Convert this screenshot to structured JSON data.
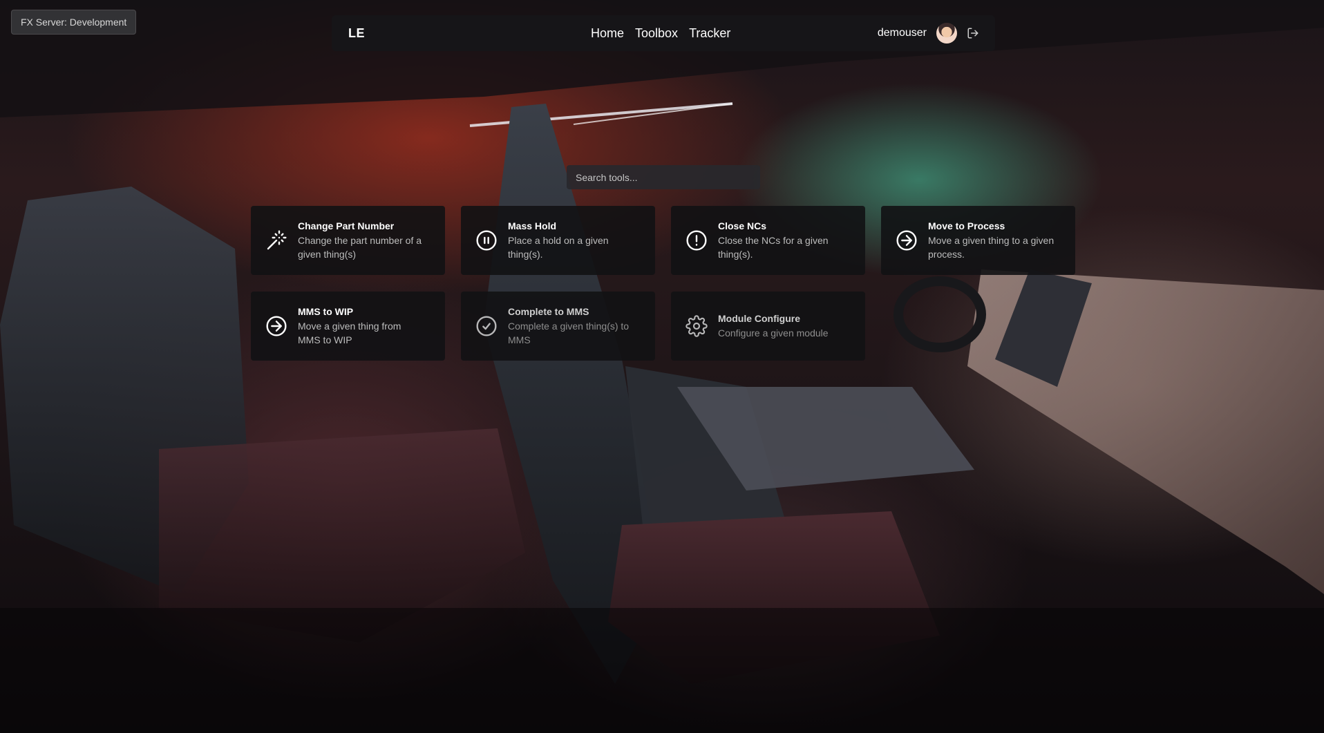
{
  "env_badge": "FX Server: Development",
  "header": {
    "brand": "LE",
    "nav": [
      "Home",
      "Toolbox",
      "Tracker"
    ],
    "username": "demouser"
  },
  "search": {
    "placeholder": "Search tools..."
  },
  "tools": [
    {
      "title": "Change Part Number",
      "desc_lines": [
        "Change the part number of a",
        "given thing(s)"
      ],
      "icon": "magic-wand-icon"
    },
    {
      "title": "Mass Hold",
      "desc_lines": [
        "Place a hold on a given",
        "thing(s)."
      ],
      "icon": "pause-circle-icon"
    },
    {
      "title": "Close NCs",
      "desc_lines": [
        "Close the NCs for a given",
        "thing(s)."
      ],
      "icon": "alert-circle-icon"
    },
    {
      "title": "Move to Process",
      "desc_lines": [
        "Move a given thing to a given",
        "process."
      ],
      "icon": "arrow-right-circle-icon"
    },
    {
      "title": "MMS to WIP",
      "desc_lines": [
        "Move a given thing from",
        "MMS to WIP"
      ],
      "icon": "arrow-right-circle-icon"
    },
    {
      "title": "Complete to MMS",
      "desc_lines": [
        "Complete a given thing(s) to",
        "MMS"
      ],
      "icon": "check-circle-icon"
    },
    {
      "title": "Module Configure",
      "desc_lines": [
        "Configure a given module"
      ],
      "icon": "gear-icon"
    }
  ]
}
